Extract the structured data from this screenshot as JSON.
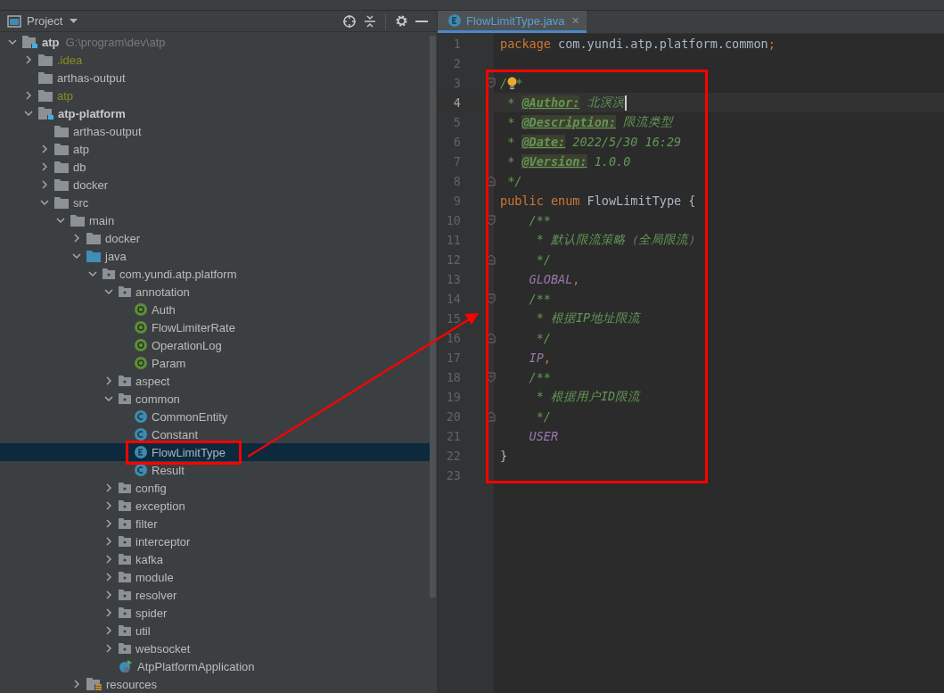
{
  "project_panel": {
    "title": "Project",
    "tree": [
      {
        "label": "atp",
        "kind": "module",
        "hint": "G:\\program\\dev\\atp",
        "expanded": true,
        "selected": false,
        "children": [
          {
            "label": ".idea",
            "kind": "excluded-folder",
            "expanded": false,
            "selected": false
          },
          {
            "label": "arthas-output",
            "kind": "folder",
            "selected": false
          },
          {
            "label": "atp",
            "kind": "excluded-folder",
            "expanded": false,
            "selected": false
          },
          {
            "label": "atp-platform",
            "kind": "module",
            "expanded": true,
            "selected": false,
            "children": [
              {
                "label": "arthas-output",
                "kind": "folder",
                "selected": false
              },
              {
                "label": "atp",
                "kind": "folder",
                "expanded": false,
                "selected": false
              },
              {
                "label": "db",
                "kind": "folder",
                "expanded": false,
                "selected": false
              },
              {
                "label": "docker",
                "kind": "folder",
                "expanded": false,
                "selected": false
              },
              {
                "label": "src",
                "kind": "folder",
                "expanded": true,
                "selected": false,
                "children": [
                  {
                    "label": "main",
                    "kind": "folder",
                    "expanded": true,
                    "selected": false,
                    "children": [
                      {
                        "label": "docker",
                        "kind": "folder",
                        "expanded": false,
                        "selected": false
                      },
                      {
                        "label": "java",
                        "kind": "source-folder",
                        "expanded": true,
                        "selected": false,
                        "children": [
                          {
                            "label": "com.yundi.atp.platform",
                            "kind": "package",
                            "expanded": true,
                            "selected": false,
                            "children": [
                              {
                                "label": "annotation",
                                "kind": "package",
                                "expanded": true,
                                "selected": false,
                                "children": [
                                  {
                                    "label": "Auth",
                                    "kind": "annotation",
                                    "selected": false
                                  },
                                  {
                                    "label": "FlowLimiterRate",
                                    "kind": "annotation",
                                    "selected": false
                                  },
                                  {
                                    "label": "OperationLog",
                                    "kind": "annotation",
                                    "selected": false
                                  },
                                  {
                                    "label": "Param",
                                    "kind": "annotation",
                                    "selected": false
                                  }
                                ]
                              },
                              {
                                "label": "aspect",
                                "kind": "package",
                                "expanded": false,
                                "selected": false
                              },
                              {
                                "label": "common",
                                "kind": "package",
                                "expanded": true,
                                "selected": false,
                                "children": [
                                  {
                                    "label": "CommonEntity",
                                    "kind": "class",
                                    "selected": false
                                  },
                                  {
                                    "label": "Constant",
                                    "kind": "class",
                                    "selected": false
                                  },
                                  {
                                    "label": "FlowLimitType",
                                    "kind": "enum",
                                    "selected": true
                                  },
                                  {
                                    "label": "Result",
                                    "kind": "class",
                                    "selected": false
                                  }
                                ]
                              },
                              {
                                "label": "config",
                                "kind": "package",
                                "expanded": false,
                                "selected": false
                              },
                              {
                                "label": "exception",
                                "kind": "package",
                                "expanded": false,
                                "selected": false
                              },
                              {
                                "label": "filter",
                                "kind": "package",
                                "expanded": false,
                                "selected": false
                              },
                              {
                                "label": "interceptor",
                                "kind": "package",
                                "expanded": false,
                                "selected": false
                              },
                              {
                                "label": "kafka",
                                "kind": "package",
                                "expanded": false,
                                "selected": false
                              },
                              {
                                "label": "module",
                                "kind": "package",
                                "expanded": false,
                                "selected": false
                              },
                              {
                                "label": "resolver",
                                "kind": "package",
                                "expanded": false,
                                "selected": false
                              },
                              {
                                "label": "spider",
                                "kind": "package",
                                "expanded": false,
                                "selected": false
                              },
                              {
                                "label": "util",
                                "kind": "package",
                                "expanded": false,
                                "selected": false
                              },
                              {
                                "label": "websocket",
                                "kind": "package",
                                "expanded": false,
                                "selected": false
                              },
                              {
                                "label": "AtpPlatformApplication",
                                "kind": "application",
                                "selected": false
                              }
                            ]
                          }
                        ]
                      },
                      {
                        "label": "resources",
                        "kind": "resources-folder",
                        "expanded": false,
                        "selected": false
                      }
                    ]
                  }
                ]
              }
            ]
          }
        ]
      }
    ]
  },
  "editor": {
    "tabs": [
      {
        "label": "FlowLimitType.java",
        "close": "×",
        "selected": true
      }
    ],
    "lines": [
      {
        "number": "1",
        "current": false,
        "fold_start": false,
        "fold_end": false,
        "tokens": [
          {
            "kind": "keyword",
            "text": "package "
          },
          {
            "kind": "plain",
            "text": "com.yundi.atp.platform.common"
          },
          {
            "kind": "keyword",
            "text": ";"
          }
        ]
      },
      {
        "number": "2",
        "current": false,
        "fold_start": false,
        "fold_end": false
      },
      {
        "number": "3",
        "current": false,
        "fold_start": true,
        "fold_end": false,
        "tokens": [
          {
            "kind": "comment",
            "text": "/"
          },
          {
            "kind": "bulb"
          },
          {
            "kind": "comment",
            "text": "*"
          }
        ]
      },
      {
        "number": "4",
        "current": true,
        "fold_start": false,
        "fold_end": false,
        "tokens": [
          {
            "kind": "comment",
            "text": " * "
          },
          {
            "kind": "doc-tag",
            "text": "@Author:"
          },
          {
            "kind": "comment",
            "text": " 北溟溟"
          },
          {
            "kind": "caret"
          }
        ]
      },
      {
        "number": "5",
        "current": false,
        "fold_start": false,
        "fold_end": false,
        "tokens": [
          {
            "kind": "comment",
            "text": " * "
          },
          {
            "kind": "doc-tag",
            "text": "@Description:"
          },
          {
            "kind": "comment",
            "text": " 限流类型"
          }
        ]
      },
      {
        "number": "6",
        "current": false,
        "fold_start": false,
        "fold_end": false,
        "tokens": [
          {
            "kind": "comment",
            "text": " * "
          },
          {
            "kind": "doc-tag",
            "text": "@Date:"
          },
          {
            "kind": "comment",
            "text": " 2022/5/30 16:29"
          }
        ]
      },
      {
        "number": "7",
        "current": false,
        "fold_start": false,
        "fold_end": false,
        "tokens": [
          {
            "kind": "comment",
            "text": " * "
          },
          {
            "kind": "doc-tag",
            "text": "@Version:"
          },
          {
            "kind": "comment",
            "text": " 1.0.0"
          }
        ]
      },
      {
        "number": "8",
        "current": false,
        "fold_start": false,
        "fold_end": true,
        "tokens": [
          {
            "kind": "comment",
            "text": " */"
          }
        ]
      },
      {
        "number": "9",
        "current": false,
        "fold_start": false,
        "fold_end": false,
        "tokens": [
          {
            "kind": "keyword",
            "text": "public enum "
          },
          {
            "kind": "plain",
            "text": "FlowLimitType {"
          }
        ]
      },
      {
        "number": "10",
        "current": false,
        "fold_start": true,
        "fold_end": false,
        "tokens": [
          {
            "kind": "comment",
            "text": "    /**"
          }
        ]
      },
      {
        "number": "11",
        "current": false,
        "fold_start": false,
        "fold_end": false,
        "tokens": [
          {
            "kind": "comment",
            "text": "     * 默认限流策略（全局限流）"
          }
        ]
      },
      {
        "number": "12",
        "current": false,
        "fold_start": false,
        "fold_end": true,
        "tokens": [
          {
            "kind": "comment",
            "text": "     */"
          }
        ]
      },
      {
        "number": "13",
        "current": false,
        "fold_start": false,
        "fold_end": false,
        "tokens": [
          {
            "kind": "constant",
            "text": "    GLOBAL"
          },
          {
            "kind": "keyword",
            "text": ","
          }
        ]
      },
      {
        "number": "14",
        "current": false,
        "fold_start": true,
        "fold_end": false,
        "tokens": [
          {
            "kind": "comment",
            "text": "    /**"
          }
        ]
      },
      {
        "number": "15",
        "current": false,
        "fold_start": false,
        "fold_end": false,
        "tokens": [
          {
            "kind": "comment",
            "text": "     * 根据IP地址限流"
          }
        ]
      },
      {
        "number": "16",
        "current": false,
        "fold_start": false,
        "fold_end": true,
        "tokens": [
          {
            "kind": "comment",
            "text": "     */"
          }
        ]
      },
      {
        "number": "17",
        "current": false,
        "fold_start": false,
        "fold_end": false,
        "tokens": [
          {
            "kind": "constant",
            "text": "    IP"
          },
          {
            "kind": "keyword",
            "text": ","
          }
        ]
      },
      {
        "number": "18",
        "current": false,
        "fold_start": true,
        "fold_end": false,
        "tokens": [
          {
            "kind": "comment",
            "text": "    /**"
          }
        ]
      },
      {
        "number": "19",
        "current": false,
        "fold_start": false,
        "fold_end": false,
        "tokens": [
          {
            "kind": "comment",
            "text": "     * 根据用户ID限流"
          }
        ]
      },
      {
        "number": "20",
        "current": false,
        "fold_start": false,
        "fold_end": true,
        "tokens": [
          {
            "kind": "comment",
            "text": "     */"
          }
        ]
      },
      {
        "number": "21",
        "current": false,
        "fold_start": false,
        "fold_end": false,
        "tokens": [
          {
            "kind": "constant",
            "text": "    USER"
          }
        ]
      },
      {
        "number": "22",
        "current": false,
        "fold_start": false,
        "fold_end": false,
        "tokens": [
          {
            "kind": "plain",
            "text": "}"
          }
        ]
      },
      {
        "number": "23",
        "current": false,
        "fold_start": false,
        "fold_end": false
      }
    ]
  }
}
